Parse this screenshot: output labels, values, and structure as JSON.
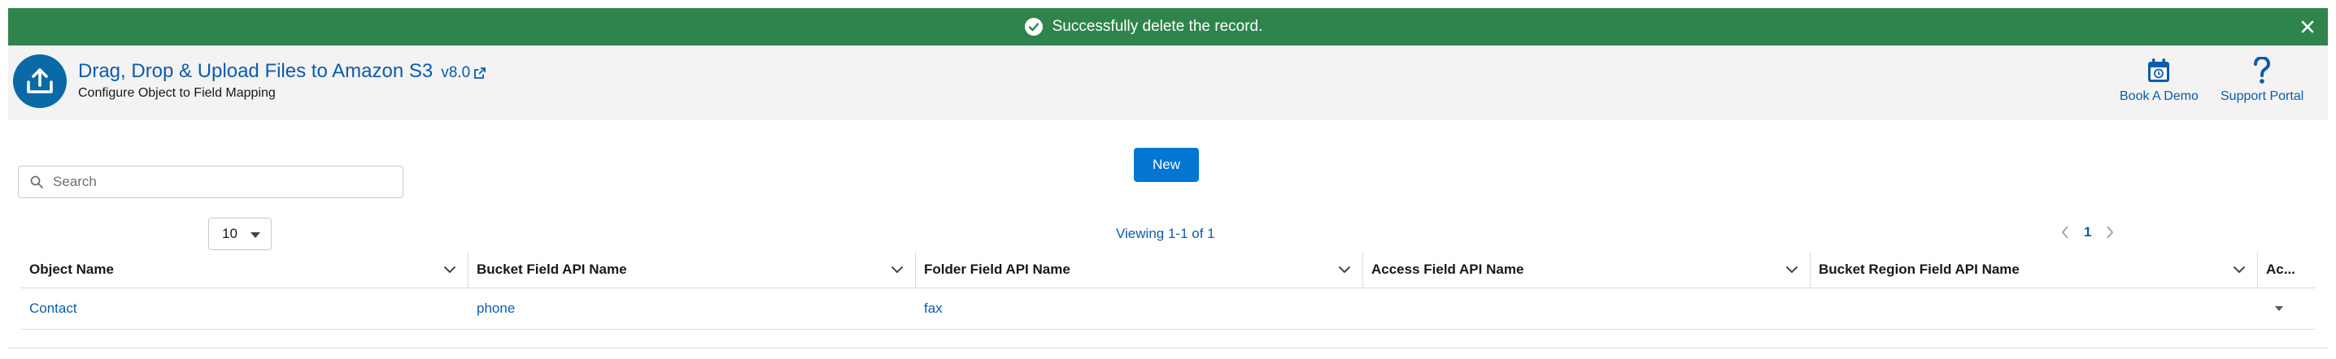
{
  "toast": {
    "message": "Successfully delete the record."
  },
  "header": {
    "title": "Drag, Drop & Upload Files to Amazon S3",
    "version": "v8.0",
    "subtitle": "Configure Object to Field Mapping",
    "actions": [
      {
        "label": "Book A Demo",
        "icon": "calendar-icon"
      },
      {
        "label": "Support Portal",
        "icon": "question-icon"
      }
    ]
  },
  "toolbar": {
    "search_placeholder": "Search",
    "new_label": "New",
    "page_size": "10",
    "viewing": "Viewing 1-1 of 1",
    "current_page": "1"
  },
  "table": {
    "columns": [
      "Object Name",
      "Bucket Field API Name",
      "Folder Field API Name",
      "Access Field API Name",
      "Bucket Region Field API Name",
      "Ac..."
    ],
    "rows": [
      [
        "Contact",
        "phone",
        "fax",
        "",
        "",
        ""
      ]
    ]
  },
  "colors": {
    "toast": "#2e844a",
    "brand": "#0176d3",
    "link": "#0b5cab",
    "logo": "#0a6aa6"
  }
}
